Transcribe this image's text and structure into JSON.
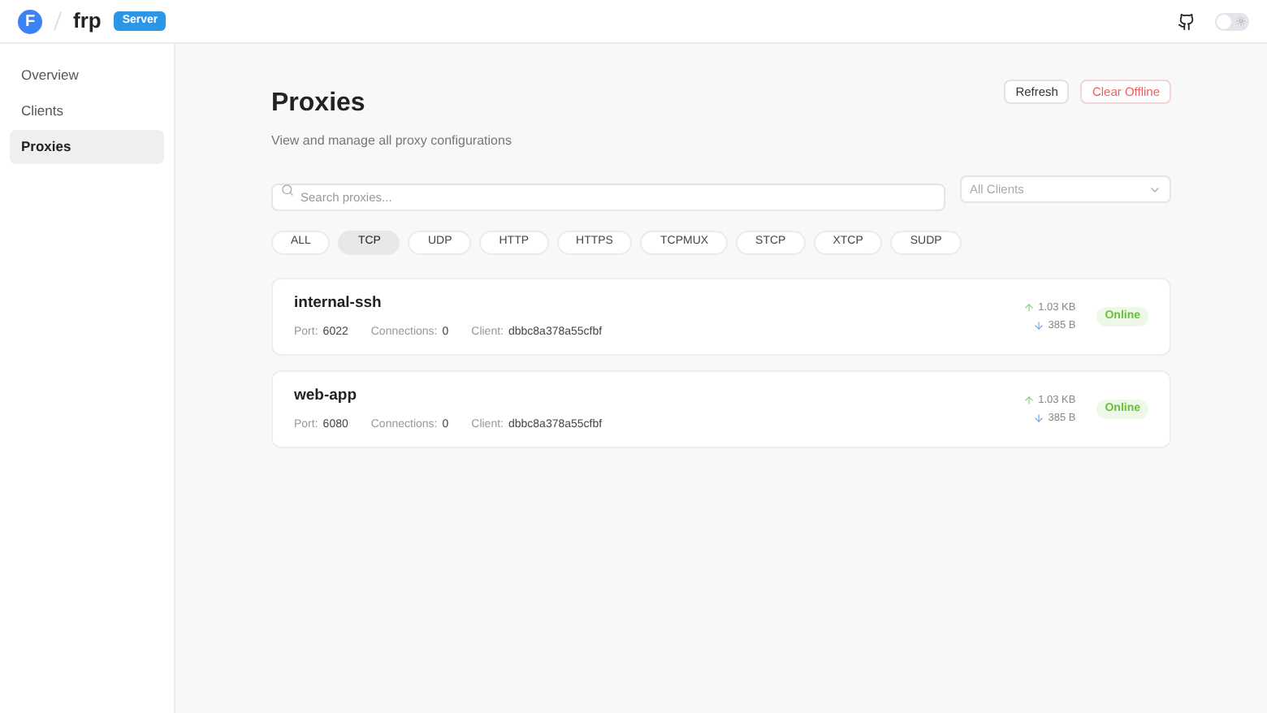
{
  "header": {
    "logo_letter": "F",
    "title": "frp",
    "badge": "Server",
    "theme_toggle": {
      "on": false
    }
  },
  "sidebar": {
    "items": [
      {
        "label": "Overview",
        "selected": false
      },
      {
        "label": "Clients",
        "selected": false
      },
      {
        "label": "Proxies",
        "selected": true
      }
    ]
  },
  "page": {
    "title": "Proxies",
    "subtitle": "View and manage all proxy configurations",
    "buttons": [
      {
        "label": "Refresh",
        "kind": "default"
      },
      {
        "label": "Clear Offline",
        "kind": "danger"
      }
    ]
  },
  "search": {
    "placeholder": "Search proxies..."
  },
  "client_filter": {
    "placeholder": "All Clients"
  },
  "tabs": [
    {
      "label": "ALL",
      "selected": false
    },
    {
      "label": "TCP",
      "selected": true
    },
    {
      "label": "UDP",
      "selected": false
    },
    {
      "label": "HTTP",
      "selected": false
    },
    {
      "label": "HTTPS",
      "selected": false
    },
    {
      "label": "TCPMUX",
      "selected": false
    },
    {
      "label": "STCP",
      "selected": false
    },
    {
      "label": "XTCP",
      "selected": false
    },
    {
      "label": "SUDP",
      "selected": false
    }
  ],
  "proxies": [
    {
      "name": "internal-ssh",
      "port_label": "Port:",
      "port": "6022",
      "connections_label": "Connections:",
      "connections": "0",
      "client_label": "Client:",
      "client": "dbbc8a378a55cfbf",
      "traffic_out": "1.03 KB",
      "traffic_in": "385 B",
      "status": "Online",
      "online": true
    },
    {
      "name": "web-app",
      "port_label": "Port:",
      "port": "6080",
      "connections_label": "Connections:",
      "connections": "0",
      "client_label": "Client:",
      "client": "dbbc8a378a55cfbf",
      "traffic_out": "1.03 KB",
      "traffic_in": "385 B",
      "status": "Online",
      "online": true
    }
  ]
}
